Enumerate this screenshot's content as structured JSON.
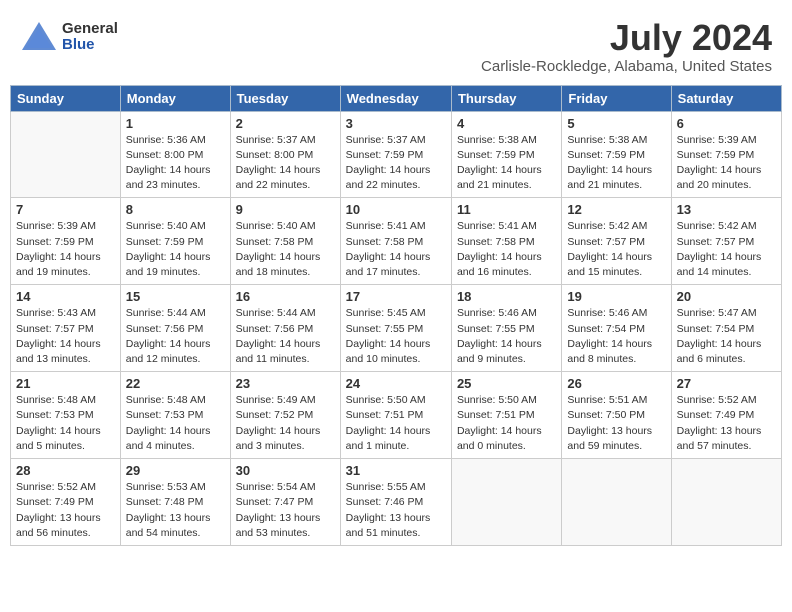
{
  "header": {
    "logo_general": "General",
    "logo_blue": "Blue",
    "title": "July 2024",
    "location": "Carlisle-Rockledge, Alabama, United States"
  },
  "days_of_week": [
    "Sunday",
    "Monday",
    "Tuesday",
    "Wednesday",
    "Thursday",
    "Friday",
    "Saturday"
  ],
  "weeks": [
    [
      {
        "day": "",
        "info": ""
      },
      {
        "day": "1",
        "info": "Sunrise: 5:36 AM\nSunset: 8:00 PM\nDaylight: 14 hours\nand 23 minutes."
      },
      {
        "day": "2",
        "info": "Sunrise: 5:37 AM\nSunset: 8:00 PM\nDaylight: 14 hours\nand 22 minutes."
      },
      {
        "day": "3",
        "info": "Sunrise: 5:37 AM\nSunset: 7:59 PM\nDaylight: 14 hours\nand 22 minutes."
      },
      {
        "day": "4",
        "info": "Sunrise: 5:38 AM\nSunset: 7:59 PM\nDaylight: 14 hours\nand 21 minutes."
      },
      {
        "day": "5",
        "info": "Sunrise: 5:38 AM\nSunset: 7:59 PM\nDaylight: 14 hours\nand 21 minutes."
      },
      {
        "day": "6",
        "info": "Sunrise: 5:39 AM\nSunset: 7:59 PM\nDaylight: 14 hours\nand 20 minutes."
      }
    ],
    [
      {
        "day": "7",
        "info": "Sunrise: 5:39 AM\nSunset: 7:59 PM\nDaylight: 14 hours\nand 19 minutes."
      },
      {
        "day": "8",
        "info": "Sunrise: 5:40 AM\nSunset: 7:59 PM\nDaylight: 14 hours\nand 19 minutes."
      },
      {
        "day": "9",
        "info": "Sunrise: 5:40 AM\nSunset: 7:58 PM\nDaylight: 14 hours\nand 18 minutes."
      },
      {
        "day": "10",
        "info": "Sunrise: 5:41 AM\nSunset: 7:58 PM\nDaylight: 14 hours\nand 17 minutes."
      },
      {
        "day": "11",
        "info": "Sunrise: 5:41 AM\nSunset: 7:58 PM\nDaylight: 14 hours\nand 16 minutes."
      },
      {
        "day": "12",
        "info": "Sunrise: 5:42 AM\nSunset: 7:57 PM\nDaylight: 14 hours\nand 15 minutes."
      },
      {
        "day": "13",
        "info": "Sunrise: 5:42 AM\nSunset: 7:57 PM\nDaylight: 14 hours\nand 14 minutes."
      }
    ],
    [
      {
        "day": "14",
        "info": "Sunrise: 5:43 AM\nSunset: 7:57 PM\nDaylight: 14 hours\nand 13 minutes."
      },
      {
        "day": "15",
        "info": "Sunrise: 5:44 AM\nSunset: 7:56 PM\nDaylight: 14 hours\nand 12 minutes."
      },
      {
        "day": "16",
        "info": "Sunrise: 5:44 AM\nSunset: 7:56 PM\nDaylight: 14 hours\nand 11 minutes."
      },
      {
        "day": "17",
        "info": "Sunrise: 5:45 AM\nSunset: 7:55 PM\nDaylight: 14 hours\nand 10 minutes."
      },
      {
        "day": "18",
        "info": "Sunrise: 5:46 AM\nSunset: 7:55 PM\nDaylight: 14 hours\nand 9 minutes."
      },
      {
        "day": "19",
        "info": "Sunrise: 5:46 AM\nSunset: 7:54 PM\nDaylight: 14 hours\nand 8 minutes."
      },
      {
        "day": "20",
        "info": "Sunrise: 5:47 AM\nSunset: 7:54 PM\nDaylight: 14 hours\nand 6 minutes."
      }
    ],
    [
      {
        "day": "21",
        "info": "Sunrise: 5:48 AM\nSunset: 7:53 PM\nDaylight: 14 hours\nand 5 minutes."
      },
      {
        "day": "22",
        "info": "Sunrise: 5:48 AM\nSunset: 7:53 PM\nDaylight: 14 hours\nand 4 minutes."
      },
      {
        "day": "23",
        "info": "Sunrise: 5:49 AM\nSunset: 7:52 PM\nDaylight: 14 hours\nand 3 minutes."
      },
      {
        "day": "24",
        "info": "Sunrise: 5:50 AM\nSunset: 7:51 PM\nDaylight: 14 hours\nand 1 minute."
      },
      {
        "day": "25",
        "info": "Sunrise: 5:50 AM\nSunset: 7:51 PM\nDaylight: 14 hours\nand 0 minutes."
      },
      {
        "day": "26",
        "info": "Sunrise: 5:51 AM\nSunset: 7:50 PM\nDaylight: 13 hours\nand 59 minutes."
      },
      {
        "day": "27",
        "info": "Sunrise: 5:52 AM\nSunset: 7:49 PM\nDaylight: 13 hours\nand 57 minutes."
      }
    ],
    [
      {
        "day": "28",
        "info": "Sunrise: 5:52 AM\nSunset: 7:49 PM\nDaylight: 13 hours\nand 56 minutes."
      },
      {
        "day": "29",
        "info": "Sunrise: 5:53 AM\nSunset: 7:48 PM\nDaylight: 13 hours\nand 54 minutes."
      },
      {
        "day": "30",
        "info": "Sunrise: 5:54 AM\nSunset: 7:47 PM\nDaylight: 13 hours\nand 53 minutes."
      },
      {
        "day": "31",
        "info": "Sunrise: 5:55 AM\nSunset: 7:46 PM\nDaylight: 13 hours\nand 51 minutes."
      },
      {
        "day": "",
        "info": ""
      },
      {
        "day": "",
        "info": ""
      },
      {
        "day": "",
        "info": ""
      }
    ]
  ]
}
